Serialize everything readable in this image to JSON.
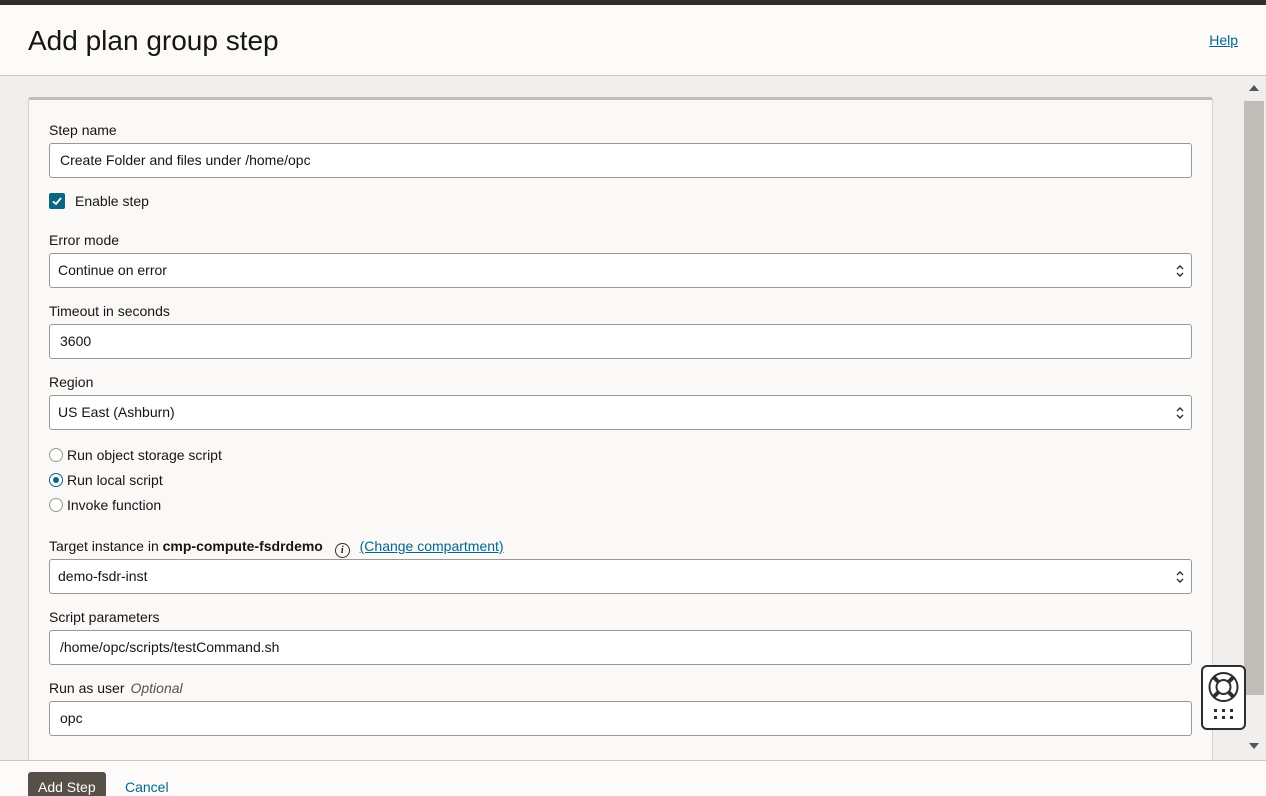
{
  "header": {
    "title": "Add plan group step",
    "help_label": "Help"
  },
  "form": {
    "step_name": {
      "label": "Step name",
      "value": "Create Folder and files under /home/opc"
    },
    "enable_step": {
      "label": "Enable step",
      "checked": true
    },
    "error_mode": {
      "label": "Error mode",
      "value": "Continue on error"
    },
    "timeout": {
      "label": "Timeout in seconds",
      "value": "3600"
    },
    "region": {
      "label": "Region",
      "value": "US East (Ashburn)"
    },
    "script_type": {
      "options": [
        "Run object storage script",
        "Run local script",
        "Invoke function"
      ],
      "selected": "Run local script"
    },
    "target_instance": {
      "label_prefix": "Target instance in",
      "compartment": "cmp-compute-fsdrdemo",
      "change_link": "(Change compartment)",
      "value": "demo-fsdr-inst"
    },
    "script_params": {
      "label": "Script parameters",
      "value": "/home/opc/scripts/testCommand.sh"
    },
    "run_as_user": {
      "label": "Run as user",
      "optional": "Optional",
      "value": "opc"
    }
  },
  "footer": {
    "add_label": "Add Step",
    "cancel_label": "Cancel"
  },
  "colors": {
    "accent": "#0d6680",
    "link": "#00688c",
    "primary_button": "#575049"
  }
}
